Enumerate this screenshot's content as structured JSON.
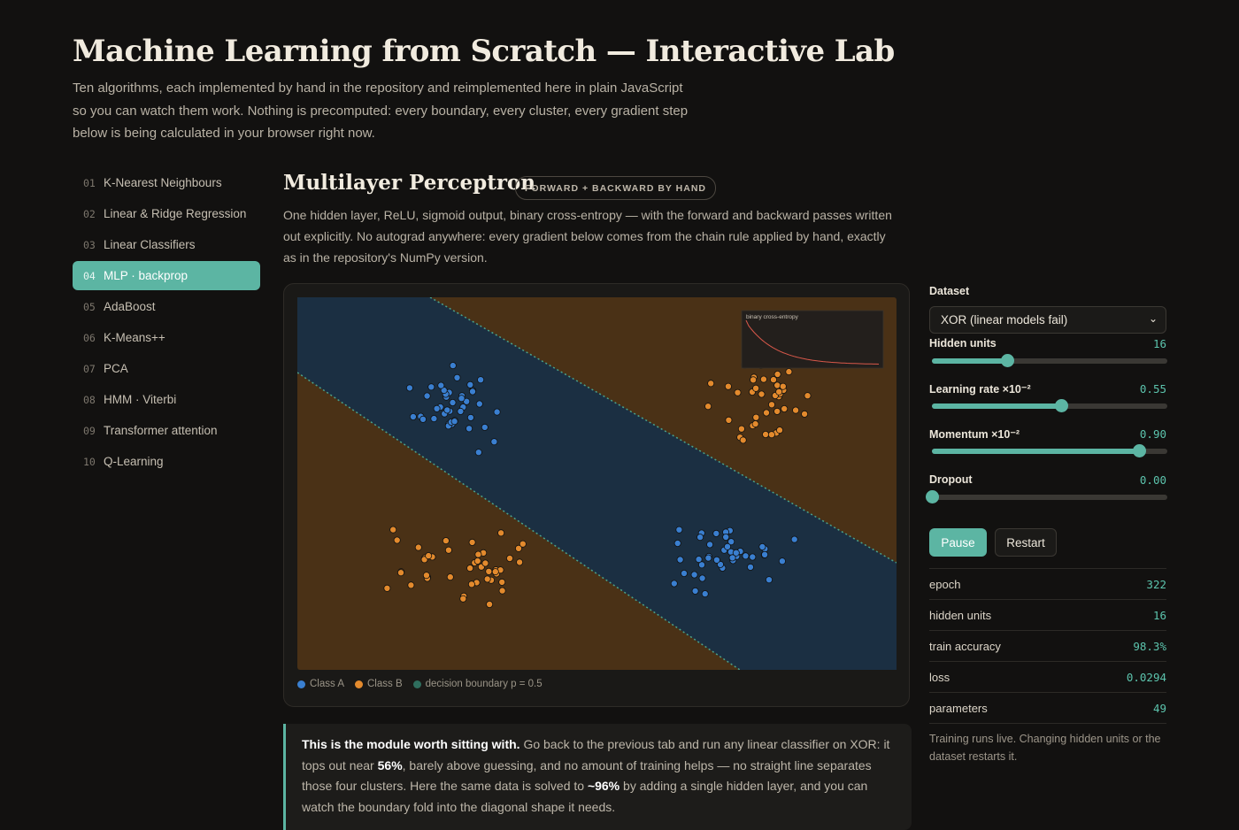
{
  "page": {
    "title": "Machine Learning from Scratch — Interactive Lab",
    "intro": "Ten algorithms, each implemented by hand in the repository and reimplemented here in plain JavaScript so you can watch them work. Nothing is precomputed: every boundary, every cluster, every gradient step below is being calculated in your browser right now."
  },
  "sidebar": {
    "items": [
      {
        "num": "01",
        "label": "K-Nearest Neighbours",
        "active": false
      },
      {
        "num": "02",
        "label": "Linear & Ridge Regression",
        "active": false
      },
      {
        "num": "03",
        "label": "Linear Classifiers",
        "active": false
      },
      {
        "num": "04",
        "label": "MLP · backprop",
        "active": true
      },
      {
        "num": "05",
        "label": "AdaBoost",
        "active": false
      },
      {
        "num": "06",
        "label": "K-Means++",
        "active": false
      },
      {
        "num": "07",
        "label": "PCA",
        "active": false
      },
      {
        "num": "08",
        "label": "HMM · Viterbi",
        "active": false
      },
      {
        "num": "09",
        "label": "Transformer attention",
        "active": false
      },
      {
        "num": "10",
        "label": "Q-Learning",
        "active": false
      }
    ]
  },
  "module": {
    "title": "Multilayer Perceptron",
    "badge": "FORWARD + BACKWARD BY HAND",
    "description": "One hidden layer, ReLU, sigmoid output, binary cross-entropy — with the forward and backward passes written out explicitly. No autograd anywhere: every gradient below comes from the chain rule applied by hand, exactly as in the repository's NumPy version."
  },
  "plot": {
    "inset_title": "binary cross-entropy",
    "legend": [
      {
        "label": "Class A",
        "color": "#3a7fd0"
      },
      {
        "label": "Class B",
        "color": "#e38a2d"
      },
      {
        "label": "decision boundary p = 0.5",
        "color": "#2f6e5e"
      }
    ],
    "colors": {
      "region_a": "#1b2f42",
      "region_b": "#4a3116",
      "point_a": "#3a7fd0",
      "point_b": "#e38a2d",
      "boundary": "#4aa38d",
      "loss_curve": "#d9584a"
    }
  },
  "callout": {
    "lead": "This is the module worth sitting with.",
    "t1": " Go back to the previous tab and run any linear classifier on XOR: it tops out near ",
    "b1": "56%",
    "t2": ", barely above guessing, and no amount of training helps — no straight line separates those four clusters. Here the same data is solved to ",
    "b2": "~96%",
    "t3": " by adding a single hidden layer, and you can watch the boundary fold into the diagonal shape it needs."
  },
  "controls": {
    "dataset_label": "Dataset",
    "dataset_value": "XOR (linear models fail)",
    "sliders": [
      {
        "label": "Hidden units",
        "value": "16",
        "fraction": 0.32
      },
      {
        "label": "Learning rate ×10⁻²",
        "value": "0.55",
        "fraction": 0.55
      },
      {
        "label": "Momentum ×10⁻²",
        "value": "0.90",
        "fraction": 0.88
      },
      {
        "label": "Dropout",
        "value": "0.00",
        "fraction": 0.0
      }
    ],
    "pause_label": "Pause",
    "restart_label": "Restart",
    "stats": [
      {
        "label": "epoch",
        "value": "322"
      },
      {
        "label": "hidden units",
        "value": "16"
      },
      {
        "label": "train accuracy",
        "value": "98.3%"
      },
      {
        "label": "loss",
        "value": "0.0294"
      },
      {
        "label": "parameters",
        "value": "49"
      }
    ],
    "note": "Training runs live. Changing hidden units or the dataset restarts it."
  }
}
